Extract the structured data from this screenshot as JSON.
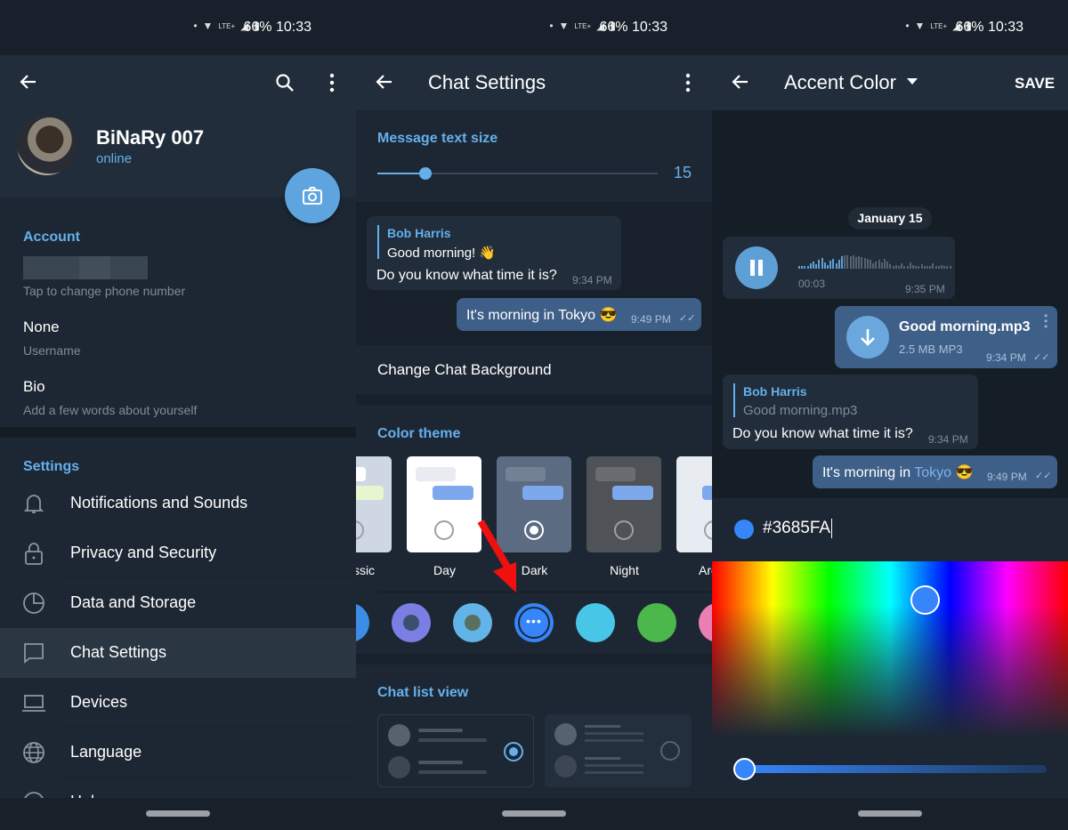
{
  "status_bar": {
    "battery": "66%",
    "time": "10:33",
    "network": "LTE+"
  },
  "profile_screen": {
    "name": "BiNaRy 007",
    "presence": "online",
    "account_header": "Account",
    "phone_hint": "Tap to change phone number",
    "username_value": "None",
    "username_label": "Username",
    "bio_value": "Bio",
    "bio_hint": "Add a few words about yourself",
    "settings_header": "Settings",
    "items": [
      {
        "label": "Notifications and Sounds",
        "icon": "bell-icon"
      },
      {
        "label": "Privacy and Security",
        "icon": "lock-icon"
      },
      {
        "label": "Data and Storage",
        "icon": "pie-chart-icon"
      },
      {
        "label": "Chat Settings",
        "icon": "chat-bubble-icon",
        "selected": true
      },
      {
        "label": "Devices",
        "icon": "laptop-icon"
      },
      {
        "label": "Language",
        "icon": "globe-icon"
      },
      {
        "label": "Help",
        "icon": "help-icon"
      }
    ]
  },
  "chat_settings_screen": {
    "title": "Chat Settings",
    "text_size_label": "Message text size",
    "text_size_value": "15",
    "text_size_fraction": 0.17,
    "preview": {
      "reply_name": "Bob Harris",
      "reply_text": "Good morning! 👋",
      "in_text": "Do you know what time it is?",
      "in_time": "9:34 PM",
      "out_text": "It's morning in Tokyo 😎",
      "out_time": "9:49 PM"
    },
    "change_background": "Change Chat Background",
    "color_theme_label": "Color theme",
    "themes": [
      {
        "label": "Classic",
        "bg": "#cfd8e2",
        "selected": false
      },
      {
        "label": "Day",
        "bg": "#ffffff",
        "selected": false
      },
      {
        "label": "Dark",
        "bg": "#5b6b82",
        "selected": true
      },
      {
        "label": "Night",
        "bg": "#4f5358",
        "selected": false
      },
      {
        "label": "Arctic",
        "bg": "#e6ecf2",
        "selected": false
      }
    ],
    "accent_colors": [
      "#3b8ee6",
      "#7b7fe3",
      "#62b4e8",
      "#3685fa",
      "#47c6e8",
      "#4cb74a",
      "#e97fb4"
    ],
    "selected_accent_index": 3,
    "chat_list_label": "Chat list view"
  },
  "accent_screen": {
    "title": "Accent Color",
    "save": "SAVE",
    "date": "January 15",
    "voice": {
      "duration": "00:03",
      "time": "9:35 PM"
    },
    "file": {
      "name": "Good morning.mp3",
      "size": "2.5 MB MP3",
      "time": "9:34 PM"
    },
    "reply": {
      "name": "Bob Harris",
      "quoted": "Good morning.mp3",
      "text": "Do you know what time it is?",
      "time": "9:34 PM"
    },
    "out": {
      "text_a": "It's morning in ",
      "text_b": "Tokyo",
      "emoji": "😎",
      "time": "9:49 PM"
    },
    "hex_value": "#3685FA",
    "brightness_fraction": 0.0
  },
  "colors": {
    "accent": "#64b0ec",
    "picked": "#3685fa",
    "outgoing": "#3e5f87",
    "fab": "#5ea5df"
  }
}
